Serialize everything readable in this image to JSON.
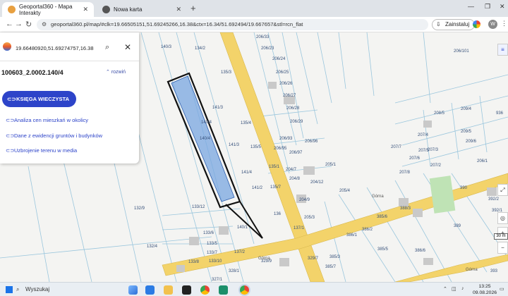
{
  "browser": {
    "tabs": [
      {
        "label": "Geoportal360 - Mapa Interakty",
        "favicon_color": "#e8a040"
      },
      {
        "label": "Nowa karta",
        "favicon_color": "#555555"
      }
    ],
    "new_tab_icon": "+",
    "address": "geoportal360.pl/map/#clk=19.66505151,51.69245266,16.38&ctx=16.34/51.692494/19.667657&stl=rcn_flat",
    "install_label": "Zainstaluj"
  },
  "panel": {
    "coords": "19.66480920,51.69274757,16.38",
    "parcel_id": "100603_2.0002.140/4",
    "expand_label": "rozwiń",
    "kw_button": "KSIĘGA WIECZYSTA",
    "links": [
      "Analiza cen mieszkań w okolicy",
      "Dane z ewidencji gruntów i budynków",
      "Uzbrojenie terenu w media"
    ]
  },
  "map": {
    "street_labels": [
      "Górna",
      "Górna",
      "Górna"
    ],
    "scale_label": "30 m",
    "plot_labels": [
      "140/3",
      "134/2",
      "206/33",
      "206/23",
      "206/101",
      "135/3",
      "206/24",
      "206/25",
      "206/26",
      "206/27",
      "206/28",
      "206/29",
      "141/3",
      "140/4",
      "135/4",
      "140/4",
      "141/3",
      "135/5",
      "206/93",
      "206/95",
      "206/97",
      "206/96",
      "205/1",
      "135/1",
      "141/4",
      "204/7",
      "204/8",
      "204/12",
      "141/2",
      "135/7",
      "205/4",
      "204/9",
      "136",
      "205/3",
      "132/9",
      "133/12",
      "140/1",
      "137/1",
      "133/6",
      "133/5",
      "132/4",
      "137/2",
      "133/7",
      "133/10",
      "133/8",
      "328/1",
      "327/1",
      "329/9",
      "329/7",
      "385/3",
      "385/7",
      "386/1",
      "386/2",
      "385/6",
      "388/3",
      "385/5",
      "386/6",
      "389",
      "390",
      "207/6",
      "207/5",
      "207/4",
      "207/3",
      "207/2",
      "207/8",
      "207/7",
      "208/5",
      "209/4",
      "209/5",
      "209/6",
      "206/1",
      "936",
      "392/2",
      "391",
      "392/1",
      "393"
    ]
  },
  "taskbar": {
    "search_placeholder": "Wyszukaj",
    "time": "13:25",
    "date": "09.08.2026"
  },
  "colors": {
    "selected_parcel_fill": "#7aa7e0",
    "selected_parcel_stroke": "#111111",
    "road_yellow": "#f3d36a",
    "accent_blue": "#2d44c9"
  }
}
